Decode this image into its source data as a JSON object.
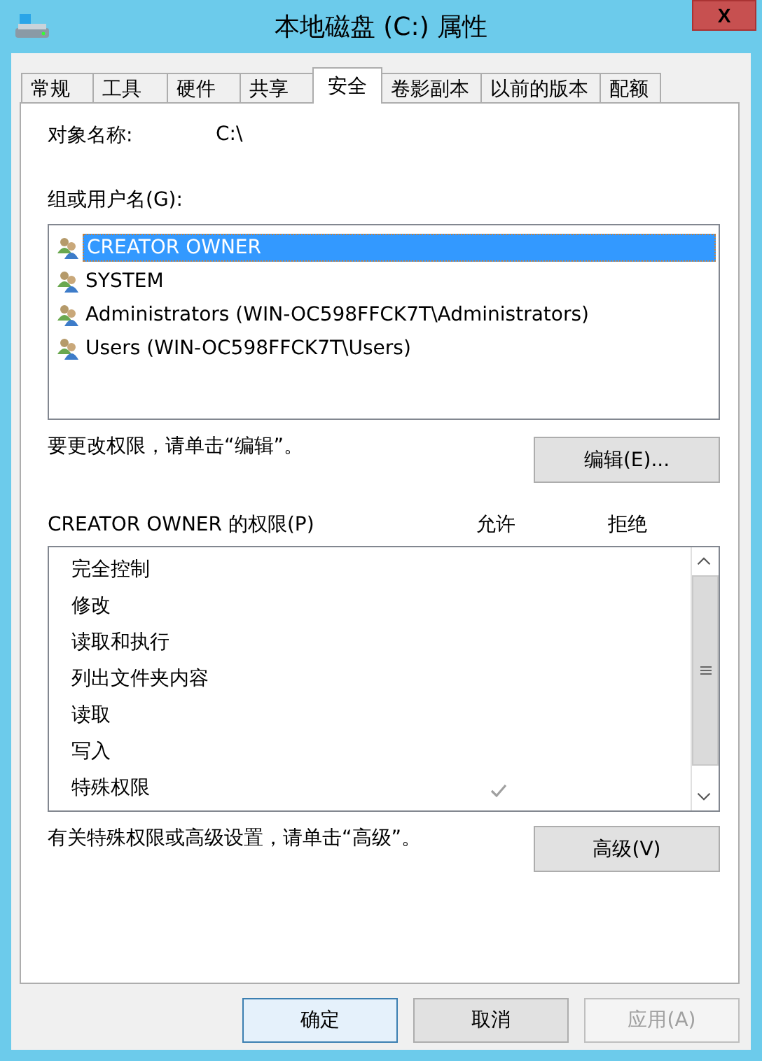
{
  "window": {
    "title": "本地磁盘 (C:) 属性",
    "close": "X"
  },
  "tabs": [
    {
      "label": "常规",
      "selected": false
    },
    {
      "label": "工具",
      "selected": false
    },
    {
      "label": "硬件",
      "selected": false
    },
    {
      "label": "共享",
      "selected": false
    },
    {
      "label": "安全",
      "selected": true
    },
    {
      "label": "卷影副本",
      "selected": false
    },
    {
      "label": "以前的版本",
      "selected": false
    },
    {
      "label": "配额",
      "selected": false
    }
  ],
  "object": {
    "label": "对象名称:",
    "value": "C:\\"
  },
  "groups": {
    "label": "组或用户名(G):",
    "items": [
      {
        "name": "CREATOR OWNER",
        "selected": true
      },
      {
        "name": "SYSTEM",
        "selected": false
      },
      {
        "name": "Administrators (WIN-OC598FFCK7T\\Administrators)",
        "selected": false
      },
      {
        "name": "Users (WIN-OC598FFCK7T\\Users)",
        "selected": false
      }
    ]
  },
  "edit_hint": "要更改权限，请单击“编辑”。",
  "edit_button": "编辑(E)...",
  "permissions": {
    "label": "CREATOR OWNER 的权限(P)",
    "allow_header": "允许",
    "deny_header": "拒绝",
    "rows": [
      {
        "name": "完全控制",
        "allow": false,
        "deny": false
      },
      {
        "name": "修改",
        "allow": false,
        "deny": false
      },
      {
        "name": "读取和执行",
        "allow": false,
        "deny": false
      },
      {
        "name": "列出文件夹内容",
        "allow": false,
        "deny": false
      },
      {
        "name": "读取",
        "allow": false,
        "deny": false
      },
      {
        "name": "写入",
        "allow": false,
        "deny": false
      },
      {
        "name": "特殊权限",
        "allow": true,
        "deny": false
      }
    ]
  },
  "advanced_hint": "有关特殊权限或高级设置，请单击“高级”。",
  "advanced_button": "高级(V)",
  "buttons": [
    {
      "label": "确定",
      "disabled": false
    },
    {
      "label": "取消",
      "disabled": false
    },
    {
      "label": "应用(A)",
      "disabled": true
    }
  ]
}
